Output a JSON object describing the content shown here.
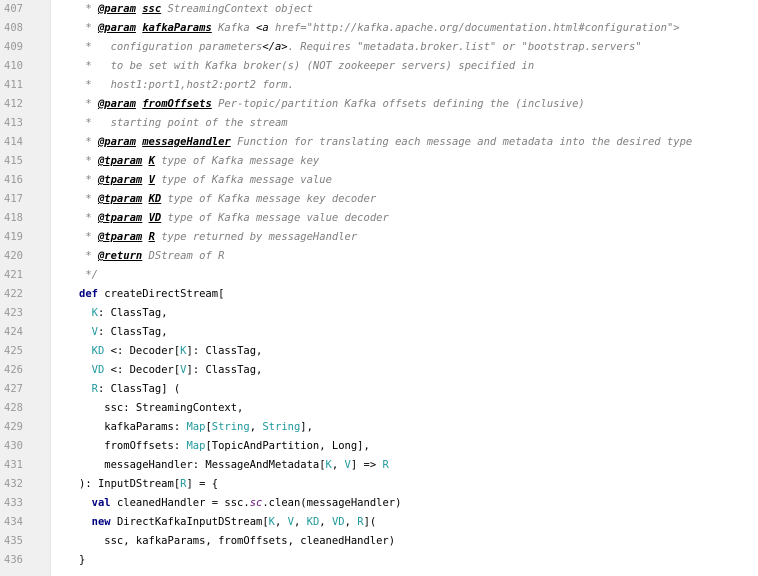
{
  "editor": {
    "lines": [
      {
        "no": "407",
        "fold": "",
        "tokens": [
          {
            "t": " * ",
            "c": "c-doc"
          },
          {
            "t": "@param",
            "c": "c-tag"
          },
          {
            "t": " ",
            "c": "c-doc"
          },
          {
            "t": "ssc",
            "c": "c-tag"
          },
          {
            "t": " StreamingContext object",
            "c": "c-doc"
          }
        ]
      },
      {
        "no": "408",
        "fold": "",
        "tokens": [
          {
            "t": " * ",
            "c": "c-doc"
          },
          {
            "t": "@param",
            "c": "c-tag"
          },
          {
            "t": " ",
            "c": "c-doc"
          },
          {
            "t": "kafkaParams",
            "c": "c-tag"
          },
          {
            "t": " Kafka ",
            "c": "c-doc"
          },
          {
            "t": "<a ",
            "c": "c-html"
          },
          {
            "t": "href=\"http://kafka.apache.org/documentation.html#configuration\">",
            "c": "c-doc"
          }
        ]
      },
      {
        "no": "409",
        "fold": "",
        "tokens": [
          {
            "t": " *   configuration parameters",
            "c": "c-doc"
          },
          {
            "t": "</a>",
            "c": "c-html"
          },
          {
            "t": ". Requires \"metadata.broker.list\" or \"bootstrap.servers\"",
            "c": "c-doc"
          }
        ]
      },
      {
        "no": "410",
        "fold": "",
        "tokens": [
          {
            "t": " *   to be set with Kafka broker(s) (NOT zookeeper servers) specified in",
            "c": "c-doc"
          }
        ]
      },
      {
        "no": "411",
        "fold": "",
        "tokens": [
          {
            "t": " *   host1:port1,host2:port2 form.",
            "c": "c-doc"
          }
        ]
      },
      {
        "no": "412",
        "fold": "",
        "tokens": [
          {
            "t": " * ",
            "c": "c-doc"
          },
          {
            "t": "@param",
            "c": "c-tag"
          },
          {
            "t": " ",
            "c": "c-doc"
          },
          {
            "t": "fromOffsets",
            "c": "c-tag"
          },
          {
            "t": " Per-topic/partition Kafka offsets defining the (inclusive)",
            "c": "c-doc"
          }
        ]
      },
      {
        "no": "413",
        "fold": "",
        "tokens": [
          {
            "t": " *   starting point of the stream",
            "c": "c-doc"
          }
        ]
      },
      {
        "no": "414",
        "fold": "",
        "tokens": [
          {
            "t": " * ",
            "c": "c-doc"
          },
          {
            "t": "@param",
            "c": "c-tag"
          },
          {
            "t": " ",
            "c": "c-doc"
          },
          {
            "t": "messageHandler",
            "c": "c-tag"
          },
          {
            "t": " Function for translating each message and metadata into the desired type",
            "c": "c-doc"
          }
        ]
      },
      {
        "no": "415",
        "fold": "",
        "tokens": [
          {
            "t": " * ",
            "c": "c-doc"
          },
          {
            "t": "@tparam",
            "c": "c-tag"
          },
          {
            "t": " ",
            "c": "c-doc"
          },
          {
            "t": "K",
            "c": "c-tag"
          },
          {
            "t": " type of Kafka message key",
            "c": "c-doc"
          }
        ]
      },
      {
        "no": "416",
        "fold": "",
        "tokens": [
          {
            "t": " * ",
            "c": "c-doc"
          },
          {
            "t": "@tparam",
            "c": "c-tag"
          },
          {
            "t": " ",
            "c": "c-doc"
          },
          {
            "t": "V",
            "c": "c-tag"
          },
          {
            "t": " type of Kafka message value",
            "c": "c-doc"
          }
        ]
      },
      {
        "no": "417",
        "fold": "",
        "tokens": [
          {
            "t": " * ",
            "c": "c-doc"
          },
          {
            "t": "@tparam",
            "c": "c-tag"
          },
          {
            "t": " ",
            "c": "c-doc"
          },
          {
            "t": "KD",
            "c": "c-tag"
          },
          {
            "t": " type of Kafka message key decoder",
            "c": "c-doc"
          }
        ]
      },
      {
        "no": "418",
        "fold": "",
        "tokens": [
          {
            "t": " * ",
            "c": "c-doc"
          },
          {
            "t": "@tparam",
            "c": "c-tag"
          },
          {
            "t": " ",
            "c": "c-doc"
          },
          {
            "t": "VD",
            "c": "c-tag"
          },
          {
            "t": " type of Kafka message value decoder",
            "c": "c-doc"
          }
        ]
      },
      {
        "no": "419",
        "fold": "",
        "tokens": [
          {
            "t": " * ",
            "c": "c-doc"
          },
          {
            "t": "@tparam",
            "c": "c-tag"
          },
          {
            "t": " ",
            "c": "c-doc"
          },
          {
            "t": "R",
            "c": "c-tag"
          },
          {
            "t": " type returned by messageHandler",
            "c": "c-doc"
          }
        ]
      },
      {
        "no": "420",
        "fold": "",
        "tokens": [
          {
            "t": " * ",
            "c": "c-doc"
          },
          {
            "t": "@return",
            "c": "c-tag"
          },
          {
            "t": " DStream of R",
            "c": "c-doc"
          }
        ]
      },
      {
        "no": "421",
        "fold": "end",
        "tokens": [
          {
            "t": " */",
            "c": "c-doc"
          }
        ]
      },
      {
        "no": "422",
        "fold": "",
        "tokens": [
          {
            "t": "def",
            "c": "c-kw"
          },
          {
            "t": " createDirectStream[",
            "c": "c-def"
          }
        ]
      },
      {
        "no": "423",
        "fold": "",
        "tokens": [
          {
            "t": "  ",
            "c": "c-plain"
          },
          {
            "t": "K",
            "c": "c-tp"
          },
          {
            "t": ": ClassTag,",
            "c": "c-plain"
          }
        ]
      },
      {
        "no": "424",
        "fold": "",
        "tokens": [
          {
            "t": "  ",
            "c": "c-plain"
          },
          {
            "t": "V",
            "c": "c-tp"
          },
          {
            "t": ": ClassTag,",
            "c": "c-plain"
          }
        ]
      },
      {
        "no": "425",
        "fold": "",
        "tokens": [
          {
            "t": "  ",
            "c": "c-plain"
          },
          {
            "t": "KD",
            "c": "c-tp"
          },
          {
            "t": " <: Decoder[",
            "c": "c-plain"
          },
          {
            "t": "K",
            "c": "c-tp"
          },
          {
            "t": "]: ClassTag,",
            "c": "c-plain"
          }
        ]
      },
      {
        "no": "426",
        "fold": "",
        "tokens": [
          {
            "t": "  ",
            "c": "c-plain"
          },
          {
            "t": "VD",
            "c": "c-tp"
          },
          {
            "t": " <: Decoder[",
            "c": "c-plain"
          },
          {
            "t": "V",
            "c": "c-tp"
          },
          {
            "t": "]: ClassTag,",
            "c": "c-plain"
          }
        ]
      },
      {
        "no": "427",
        "fold": "",
        "tokens": [
          {
            "t": "  ",
            "c": "c-plain"
          },
          {
            "t": "R",
            "c": "c-tp"
          },
          {
            "t": ": ClassTag] (",
            "c": "c-plain"
          }
        ]
      },
      {
        "no": "428",
        "fold": "",
        "tokens": [
          {
            "t": "    ssc: StreamingContext,",
            "c": "c-plain"
          }
        ]
      },
      {
        "no": "429",
        "fold": "",
        "tokens": [
          {
            "t": "    kafkaParams: ",
            "c": "c-plain"
          },
          {
            "t": "Map",
            "c": "c-str"
          },
          {
            "t": "[",
            "c": "c-plain"
          },
          {
            "t": "String",
            "c": "c-str"
          },
          {
            "t": ", ",
            "c": "c-plain"
          },
          {
            "t": "String",
            "c": "c-str"
          },
          {
            "t": "],",
            "c": "c-plain"
          }
        ]
      },
      {
        "no": "430",
        "fold": "",
        "tokens": [
          {
            "t": "    fromOffsets: ",
            "c": "c-plain"
          },
          {
            "t": "Map",
            "c": "c-str"
          },
          {
            "t": "[TopicAndPartition, Long],",
            "c": "c-plain"
          }
        ]
      },
      {
        "no": "431",
        "fold": "",
        "tokens": [
          {
            "t": "    messageHandler: MessageAndMetadata[",
            "c": "c-plain"
          },
          {
            "t": "K",
            "c": "c-tp"
          },
          {
            "t": ", ",
            "c": "c-plain"
          },
          {
            "t": "V",
            "c": "c-tp"
          },
          {
            "t": "] => ",
            "c": "c-plain"
          },
          {
            "t": "R",
            "c": "c-tp"
          }
        ]
      },
      {
        "no": "432",
        "fold": "start",
        "tokens": [
          {
            "t": "): InputDStream[",
            "c": "c-plain"
          },
          {
            "t": "R",
            "c": "c-tp"
          },
          {
            "t": "] = {",
            "c": "c-plain"
          }
        ]
      },
      {
        "no": "433",
        "fold": "",
        "tokens": [
          {
            "t": "  ",
            "c": "c-plain"
          },
          {
            "t": "val",
            "c": "c-kw"
          },
          {
            "t": " cleanedHandler = ssc.",
            "c": "c-plain"
          },
          {
            "t": "sc",
            "c": "c-mut"
          },
          {
            "t": ".clean(messageHandler)",
            "c": "c-plain"
          }
        ]
      },
      {
        "no": "434",
        "fold": "",
        "tokens": [
          {
            "t": "  ",
            "c": "c-plain"
          },
          {
            "t": "new",
            "c": "c-kw"
          },
          {
            "t": " DirectKafkaInputDStream[",
            "c": "c-plain"
          },
          {
            "t": "K",
            "c": "c-tp"
          },
          {
            "t": ", ",
            "c": "c-plain"
          },
          {
            "t": "V",
            "c": "c-tp"
          },
          {
            "t": ", ",
            "c": "c-plain"
          },
          {
            "t": "KD",
            "c": "c-tp"
          },
          {
            "t": ", ",
            "c": "c-plain"
          },
          {
            "t": "VD",
            "c": "c-tp"
          },
          {
            "t": ", ",
            "c": "c-plain"
          },
          {
            "t": "R",
            "c": "c-tp"
          },
          {
            "t": "](",
            "c": "c-plain"
          }
        ]
      },
      {
        "no": "435",
        "fold": "",
        "tokens": [
          {
            "t": "    ssc, kafkaParams, fromOffsets, cleanedHandler)",
            "c": "c-plain"
          }
        ]
      },
      {
        "no": "436",
        "fold": "end",
        "tokens": [
          {
            "t": "}",
            "c": "c-plain"
          }
        ]
      }
    ]
  }
}
